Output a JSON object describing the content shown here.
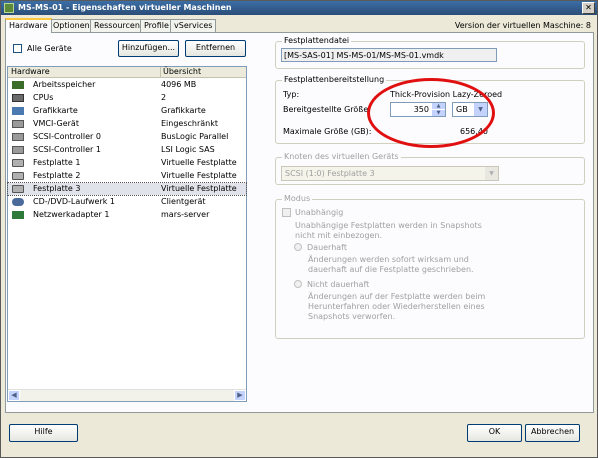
{
  "window": {
    "title": "MS-MS-01 - Eigenschaften virtueller Maschinen",
    "close_glyph": "✕"
  },
  "tabs": [
    {
      "label": "Hardware",
      "active": true
    },
    {
      "label": "Optionen"
    },
    {
      "label": "Ressourcen"
    },
    {
      "label": "Profile"
    },
    {
      "label": "vServices"
    }
  ],
  "version": "Version der virtuellen Maschine: 8",
  "toolbar": {
    "show_all_label": "Alle Geräte",
    "add_label": "Hinzufügen...",
    "remove_label": "Entfernen"
  },
  "hardware_table": {
    "headers": [
      "Hardware",
      "Übersicht"
    ],
    "rows": [
      {
        "icon": "memory-icon",
        "name": "Arbeitsspeicher",
        "summary": "4096 MB"
      },
      {
        "icon": "cpu-icon",
        "name": "CPUs",
        "summary": "2"
      },
      {
        "icon": "graphics-card-icon",
        "name": "Grafikkarte",
        "summary": "Grafikkarte"
      },
      {
        "icon": "vmci-icon",
        "name": "VMCI-Gerät",
        "summary": "Eingeschränkt"
      },
      {
        "icon": "scsi-controller-icon",
        "name": "SCSI-Controller 0",
        "summary": "BusLogic Parallel"
      },
      {
        "icon": "scsi-controller-icon",
        "name": "SCSI-Controller 1",
        "summary": "LSI Logic SAS"
      },
      {
        "icon": "hard-disk-icon",
        "name": "Festplatte 1",
        "summary": "Virtuelle Festplatte"
      },
      {
        "icon": "hard-disk-icon",
        "name": "Festplatte 2",
        "summary": "Virtuelle Festplatte"
      },
      {
        "icon": "hard-disk-icon",
        "name": "Festplatte 3",
        "summary": "Virtuelle Festplatte",
        "selected": true
      },
      {
        "icon": "cd-dvd-icon",
        "name": "CD-/DVD-Laufwerk 1",
        "summary": "Clientgerät"
      },
      {
        "icon": "network-adapter-icon",
        "name": "Netzwerkadapter 1",
        "summary": "mars-server"
      }
    ]
  },
  "scroll_left_glyph": "◀",
  "scroll_right_glyph": "▶",
  "disk_file": {
    "group_title": "Festplattendatei",
    "path": "[MS-SAS-01] MS-MS-01/MS-MS-01.vmdk"
  },
  "provisioning": {
    "group_title": "Festplattenbereitstellung",
    "type_label": "Typ:",
    "type_value": "Thick-Provision Lazy-Zeroed",
    "size_label": "Bereitgestellte Größe:",
    "size_value": "350",
    "size_unit": "GB",
    "max_label": "Maximale Größe (GB):",
    "max_value": "656,40",
    "spin_up_glyph": "▲",
    "spin_down_glyph": "▼",
    "dropdown_glyph": "▼"
  },
  "virtual_device_node": {
    "group_title": "Knoten des virtuellen Geräts",
    "selected": "SCSI (1:0) Festplatte 3"
  },
  "mode": {
    "group_title": "Modus",
    "independent_label": "Unabhängig",
    "independent_desc": "Unabhängige Festplatten werden in Snapshots nicht mit einbezogen.",
    "persistent_label": "Dauerhaft",
    "persistent_desc": "Änderungen werden sofort wirksam und dauerhaft auf die Festplatte geschrieben.",
    "nonpersistent_label": "Nicht dauerhaft",
    "nonpersistent_desc": "Änderungen auf der Festplatte werden beim Herunterfahren oder Wiederherstellen eines Snapshots verworfen."
  },
  "footer": {
    "help_label": "Hilfe",
    "ok_label": "OK",
    "cancel_label": "Abbrechen"
  },
  "colors": {
    "accent": "#3b6ea5",
    "annotation_oval": "#e01010"
  }
}
